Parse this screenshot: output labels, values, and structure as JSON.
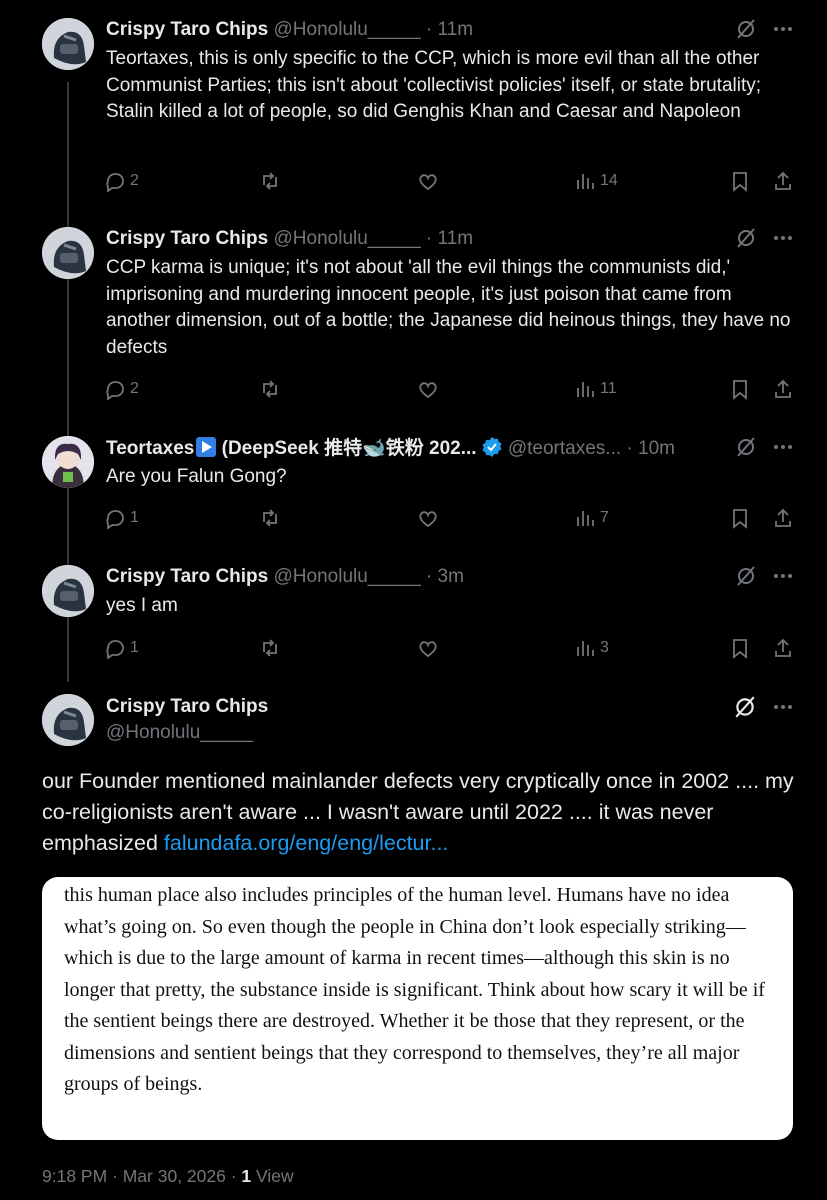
{
  "tweets": [
    {
      "name": "Crispy Taro Chips",
      "handle": "@Honolulu_____",
      "time": "11m",
      "text": "Teortaxes, this is only specific to the CCP, which is more evil than all the other Communist Parties; this isn't about 'collectivist policies' itself, or state brutality; Stalin killed a lot of people, so did Genghis Khan and Caesar and Napoleon",
      "replies": "2",
      "views": "14"
    },
    {
      "name": "Crispy Taro Chips",
      "handle": "@Honolulu_____",
      "time": "11m",
      "text": "CCP karma is unique; it's not about 'all the evil things the communists did,' imprisoning and murdering innocent people, it's just poison that came from another dimension, out of a bottle; the Japanese did heinous things, they have no defects",
      "replies": "2",
      "views": "11"
    },
    {
      "name_prefix": "Teortaxes",
      "name_suffix": " (DeepSeek 推特🐋铁粉 202...",
      "handle": "@teortaxes...",
      "time": "10m",
      "text": "Are you Falun Gong?",
      "replies": "1",
      "views": "7"
    },
    {
      "name": "Crispy Taro Chips",
      "handle": "@Honolulu_____",
      "time": "3m",
      "text": "yes I am",
      "replies": "1",
      "views": "3"
    }
  ],
  "main_tweet": {
    "name": "Crispy Taro Chips",
    "handle": "@Honolulu_____",
    "text": "our Founder mentioned mainlander defects very cryptically once in 2002 .... my co-religionists aren't aware ... I wasn't aware until 2022 .... it was never emphasized ",
    "link": "falundafa.org/eng/eng/lectur...",
    "quote_image_text": "this human place also includes principles of the human level. Humans have no idea what’s going on. So even though the people in China don’t look especially striking—which is due to the large amount of karma in recent times—although this skin is no longer that pretty, the substance inside is significant. Think about how scary it will be if the sentient beings there are destroyed. Whether it be those that they represent, or the dimensions and sentient beings that they correspond to themselves, they’re all major groups of beings.",
    "timestamp": "9:18 PM · Mar 30, 2026 · ",
    "view_count": "1",
    "view_label": " View"
  },
  "separator": "·",
  "colors": {
    "background": "#000000",
    "text": "#e7e9ea",
    "muted": "#71767b",
    "link": "#1d9bf0",
    "verified": "#1d9bf0"
  },
  "icons": [
    "reply-icon",
    "retweet-icon",
    "like-icon",
    "views-icon",
    "bookmark-icon",
    "share-icon",
    "grok-icon",
    "more-icon",
    "verified-icon"
  ]
}
